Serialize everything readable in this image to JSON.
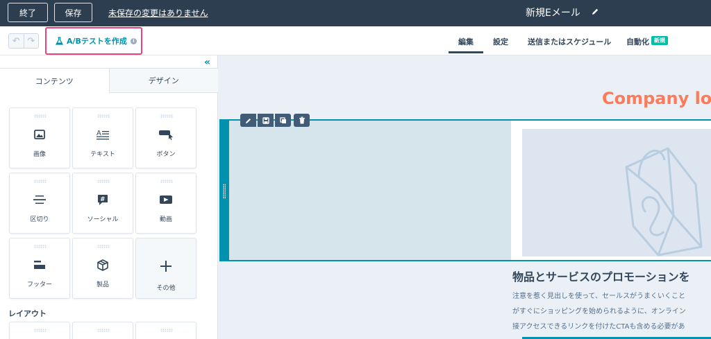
{
  "topbar": {
    "exit_label": "終了",
    "save_label": "保存",
    "unsaved_text": "未保存の変更はありません",
    "email_title": "新規Eメール"
  },
  "subbar": {
    "ab_test_label": "A/Bテストを作成",
    "tabs": [
      {
        "label": "編集",
        "active": true
      },
      {
        "label": "設定",
        "active": false
      },
      {
        "label": "送信またはスケジュール",
        "active": false
      },
      {
        "label": "自動化",
        "active": false
      }
    ],
    "new_badge": "新規"
  },
  "panel": {
    "tabs": [
      {
        "label": "コンテンツ",
        "active": true
      },
      {
        "label": "デザイン",
        "active": false
      }
    ],
    "modules": [
      {
        "label": "画像",
        "icon": "image-icon"
      },
      {
        "label": "テキスト",
        "icon": "text-icon"
      },
      {
        "label": "ボタン",
        "icon": "button-icon"
      },
      {
        "label": "区切り",
        "icon": "divider-icon"
      },
      {
        "label": "ソーシャル",
        "icon": "social-icon"
      },
      {
        "label": "動画",
        "icon": "video-icon"
      },
      {
        "label": "フッター",
        "icon": "footer-icon"
      },
      {
        "label": "製品",
        "icon": "product-icon"
      },
      {
        "label": "その他",
        "icon": "plus-icon"
      }
    ],
    "layout_label": "レイアウト"
  },
  "canvas": {
    "logo_text": "Company log",
    "heading": "物品とサービスのプロモーションを",
    "body_lines": [
      "注意を惹く見出しを使って、セールスがうまくいくこと",
      "がすぐにショッピングを始められるように、オンライン",
      "接アクセスできるリンクを付けたCTAも含める必要があ"
    ]
  },
  "colors": {
    "topbar_bg": "#2d3e50",
    "accent": "#0091ae",
    "logo": "#ff7a59",
    "highlight": "#e8437a",
    "badge": "#00bda5"
  }
}
